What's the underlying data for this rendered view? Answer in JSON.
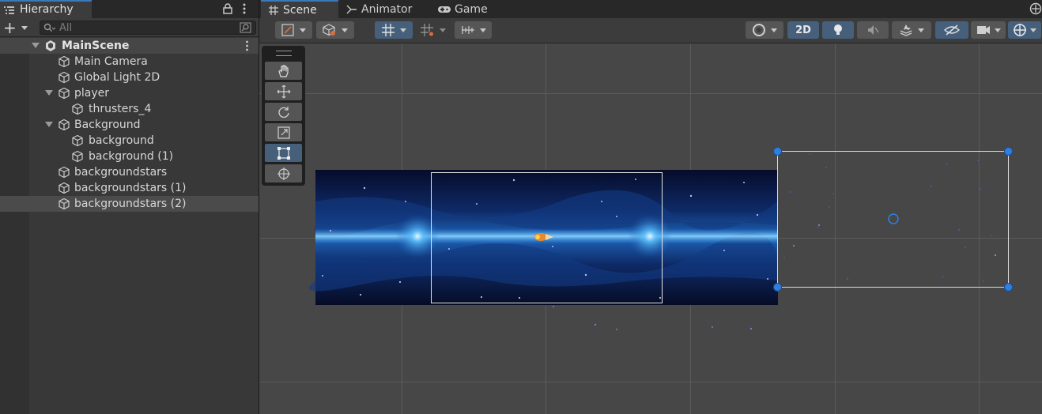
{
  "hierarchy": {
    "title": "Hierarchy",
    "add_label": "+",
    "search_placeholder": "All",
    "scene_name": "MainScene",
    "items": [
      {
        "label": "Main Camera"
      },
      {
        "label": "Global Light 2D"
      },
      {
        "label": "player"
      },
      {
        "label": "thrusters_4"
      },
      {
        "label": "Background"
      },
      {
        "label": "background"
      },
      {
        "label": "background (1)"
      },
      {
        "label": "backgroundstars"
      },
      {
        "label": "backgroundstars (1)"
      },
      {
        "label": "backgroundstars (2)"
      }
    ]
  },
  "scene_tabs": [
    {
      "label": "Scene",
      "icon": "grid-icon"
    },
    {
      "label": "Animator",
      "icon": "animator-icon"
    },
    {
      "label": "Game",
      "icon": "gamepad-icon"
    }
  ],
  "toolbar": {
    "mode_2d_label": "2D"
  },
  "colors": {
    "accent": "#3a79bb",
    "selection_handle": "#2f7fe0",
    "viewport_bg": "#474747",
    "panel_bg": "#383838"
  }
}
